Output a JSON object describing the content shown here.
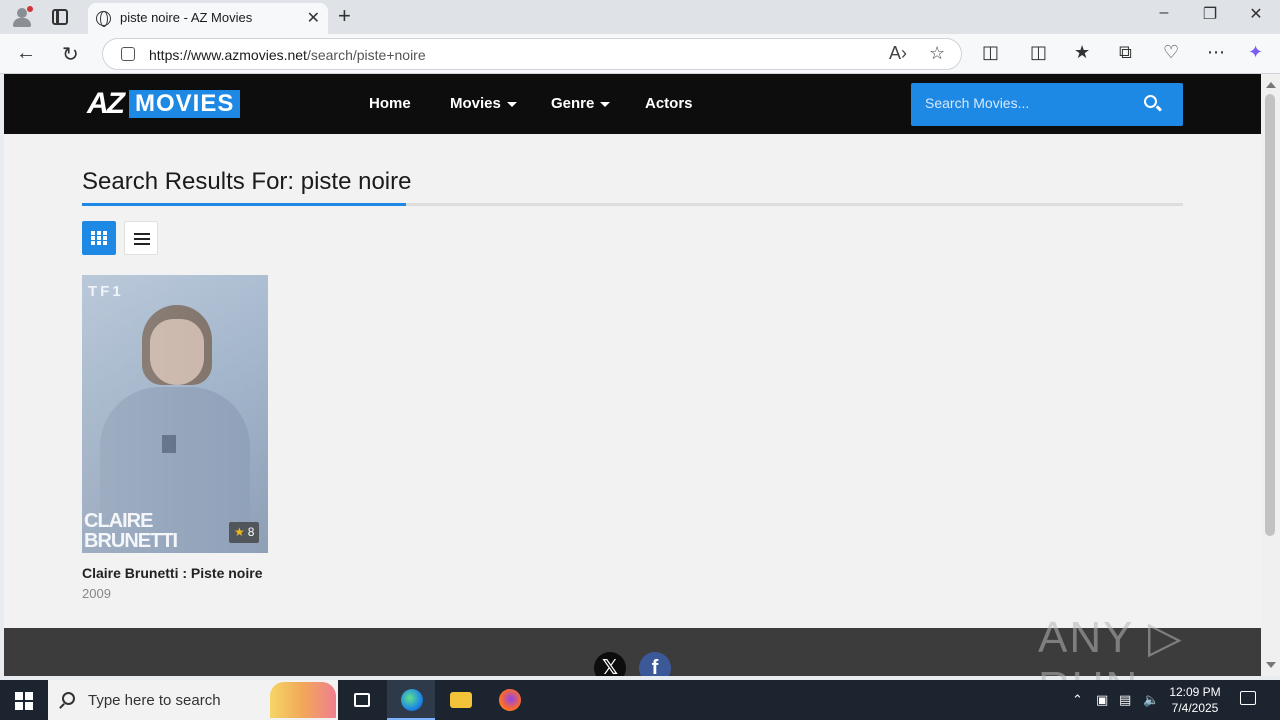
{
  "browser": {
    "tab_title": "piste noire - AZ Movies",
    "url_host": "https://www.azmovies.net",
    "url_path": "/search/piste+noire",
    "new_tab": "+",
    "close_tab": "✕"
  },
  "site": {
    "logo_az": "AZ",
    "logo_movies": "MOVIES",
    "nav": {
      "home": "Home",
      "movies": "Movies",
      "genre": "Genre",
      "actors": "Actors"
    },
    "search_placeholder": "Search Movies..."
  },
  "main": {
    "results_title": "Search Results For: piste noire",
    "view_modes": [
      "grid",
      "list"
    ],
    "active_view": "grid",
    "results": [
      {
        "title": "Claire Brunetti : Piste noire",
        "year": "2009",
        "rating": "8",
        "poster_network": "TF1",
        "poster_title_line1": "CLAIRE",
        "poster_title_line2": "BRUNETTI"
      }
    ]
  },
  "footer": {
    "social": [
      "x-icon",
      "facebook-icon"
    ],
    "x_glyph": "𝕏",
    "fb_glyph": "f"
  },
  "watermark": "ANY ▷ RUN",
  "taskbar": {
    "search_placeholder": "Type here to search",
    "time": "12:09 PM",
    "date": "7/4/2025"
  },
  "colors": {
    "accent": "#1e88e5",
    "header_bg": "#0d0d0d",
    "page_bg": "#f2f2f2",
    "rating_star": "#f2b81b"
  }
}
